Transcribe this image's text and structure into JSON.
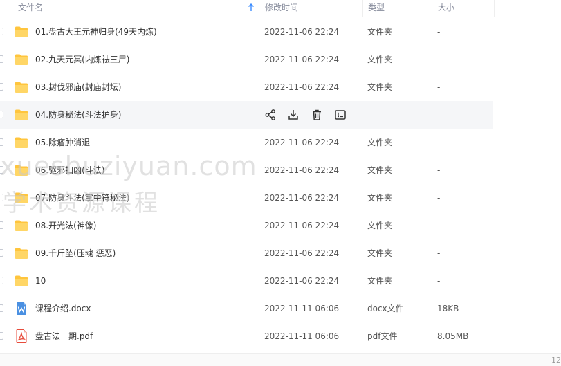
{
  "header": {
    "name": "文件名",
    "modified": "修改时间",
    "type": "类型",
    "size": "大小"
  },
  "rows": [
    {
      "name": "01.盘古大王元神归身(49天内炼)",
      "date": "2022-11-06 22:24",
      "type": "文件夹",
      "size": "-",
      "icon": "folder-icon"
    },
    {
      "name": "02.九天元冥(内炼祛三尸)",
      "date": "2022-11-06 22:24",
      "type": "文件夹",
      "size": "-",
      "icon": "folder-icon"
    },
    {
      "name": "03.封伐邪庙(封庙封坛)",
      "date": "2022-11-06 22:24",
      "type": "文件夹",
      "size": "-",
      "icon": "folder-icon"
    },
    {
      "name": "04.防身秘法(斗法护身)",
      "date": "",
      "type": "",
      "size": "",
      "icon": "folder-icon",
      "hover": true
    },
    {
      "name": "05.除瘤肿消退",
      "date": "2022-11-06 22:24",
      "type": "文件夹",
      "size": "-",
      "icon": "folder-icon"
    },
    {
      "name": "06.驱邪扫凶(斗法)",
      "date": "2022-11-06 22:24",
      "type": "文件夹",
      "size": "-",
      "icon": "folder-icon"
    },
    {
      "name": "07.防身斗法(掌中符秘法)",
      "date": "2022-11-06 22:24",
      "type": "文件夹",
      "size": "-",
      "icon": "folder-icon"
    },
    {
      "name": "08.开光法(神像)",
      "date": "2022-11-06 22:24",
      "type": "文件夹",
      "size": "-",
      "icon": "folder-icon"
    },
    {
      "name": "09.千斤坠(压魂 惩恶)",
      "date": "2022-11-06 22:24",
      "type": "文件夹",
      "size": "-",
      "icon": "folder-icon"
    },
    {
      "name": "10",
      "date": "2022-11-06 22:24",
      "type": "文件夹",
      "size": "-",
      "icon": "folder-icon"
    },
    {
      "name": "课程介绍.docx",
      "date": "2022-11-11 06:06",
      "type": "docx文件",
      "size": "18KB",
      "icon": "word-doc-icon"
    },
    {
      "name": "盘古法一期.pdf",
      "date": "2022-11-11 06:06",
      "type": "pdf文件",
      "size": "8.05MB",
      "icon": "pdf-icon"
    }
  ],
  "watermark": {
    "line1": "xueshuziyuan.com",
    "line2": "学术资源课程"
  },
  "pager": "12",
  "colors": {
    "folder": "#ffc53d",
    "word": "#4a90e2",
    "pdf": "#e74c3c"
  }
}
